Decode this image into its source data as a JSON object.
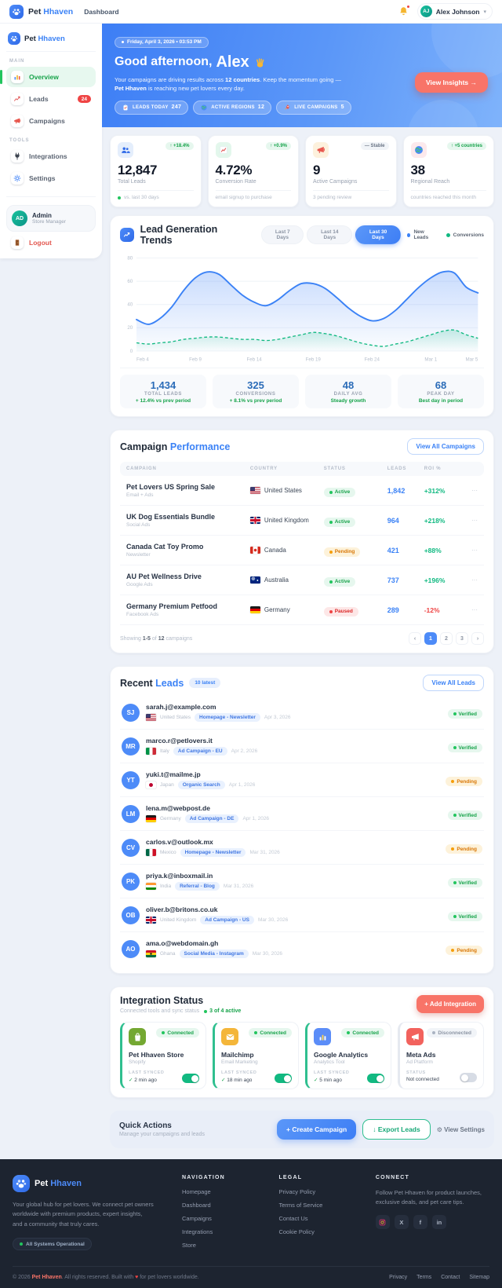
{
  "topnav": {
    "brand": {
      "first": "Pet",
      "second": "Hhaven"
    },
    "links": [
      {
        "label": "Dashboard"
      }
    ],
    "user": {
      "initials": "AJ",
      "name": "Alex Johnson"
    }
  },
  "sidebar": {
    "brand": {
      "first": "Pet",
      "second": "Hhaven"
    },
    "sections": [
      {
        "heading": "MAIN",
        "items": [
          {
            "label": "Overview",
            "icon": "bar-chart-icon",
            "active": true
          },
          {
            "label": "Leads",
            "icon": "trend-line-icon",
            "badge": "24"
          },
          {
            "label": "Campaigns",
            "icon": "megaphone-icon"
          }
        ]
      },
      {
        "heading": "TOOLS",
        "items": [
          {
            "label": "Integrations",
            "icon": "plug-icon"
          },
          {
            "label": "Settings",
            "icon": "gear-icon"
          }
        ]
      }
    ],
    "profile": {
      "initials": "AD",
      "name": "Admin",
      "role": "Store Manager"
    },
    "logout_label": "Logout"
  },
  "hero": {
    "date_pill": "Friday, April 3, 2026 • 03:53 PM",
    "greeting": "Good afternoon,",
    "greeting_name": "Alex",
    "message": {
      "p1": "Your campaigns are driving results across ",
      "b1": "12 countries",
      "p2": ". Keep the momentum going — ",
      "b2": "Pet Hhaven",
      "p3": " is reaching new pet lovers every day."
    },
    "cta_label": "View Insights →",
    "chips": [
      {
        "icon": "clipboard-icon",
        "label": "LEADS TODAY",
        "value": "247"
      },
      {
        "icon": "globe-icon",
        "label": "ACTIVE REGIONS",
        "value": "12"
      },
      {
        "icon": "rocket-icon",
        "label": "LIVE CAMPAIGNS",
        "value": "5"
      }
    ]
  },
  "stat_cards": [
    {
      "icon": "users-icon",
      "tint": "blue",
      "badge": "↑ +18.4%",
      "badge_tone": "positive",
      "value": "12,847",
      "label": "Total Leads",
      "footnote": "vs. last 30 days",
      "footnote_dot": true
    },
    {
      "icon": "chart-up-icon",
      "tint": "green",
      "badge": "↑ +0.9%",
      "badge_tone": "positive",
      "value": "4.72%",
      "label": "Conversion Rate",
      "footnote": "email signup to purchase"
    },
    {
      "icon": "megaphone-icon",
      "tint": "orange",
      "badge": "— Stable",
      "badge_tone": "neutral",
      "value": "9",
      "label": "Active Campaigns",
      "footnote": "3 pending review"
    },
    {
      "icon": "globe-icon",
      "tint": "pink",
      "badge": "↑ +5 countries",
      "badge_tone": "positive",
      "value": "38",
      "label": "Regional Reach",
      "footnote": "countries reached this month"
    }
  ],
  "trends": {
    "title": "Lead Generation Trends",
    "tabs": [
      {
        "label": "Last 7 Days",
        "active": false
      },
      {
        "label": "Last 14 Days",
        "active": false
      },
      {
        "label": "Last 30 Days",
        "active": true
      }
    ],
    "summary": [
      {
        "value": "1,434",
        "label": "TOTAL LEADS",
        "note": "+ 12.4% vs prev period"
      },
      {
        "value": "325",
        "label": "CONVERSIONS",
        "note": "+ 8.1% vs prev period"
      },
      {
        "value": "48",
        "label": "DAILY AVG",
        "note": "Steady growth"
      },
      {
        "value": "68",
        "label": "PEAK DAY",
        "note": "Best day in period"
      }
    ]
  },
  "chart_data": {
    "type": "area",
    "title": "Lead Generation Trends",
    "x_ticks": [
      "Feb 4",
      "Feb 9",
      "Feb 14",
      "Feb 19",
      "Feb 24",
      "Mar 1",
      "Mar 5"
    ],
    "x_tick_indices": [
      0,
      5,
      10,
      15,
      20,
      25,
      29
    ],
    "ylim": [
      0,
      80
    ],
    "y_ticks": [
      0,
      20,
      40,
      60,
      80
    ],
    "grid": true,
    "legend_position": "top-right",
    "series": [
      {
        "name": "New Leads",
        "color": "#3b82f6",
        "style": "solid",
        "values": [
          27,
          23,
          28,
          38,
          52,
          63,
          68,
          66,
          57,
          48,
          42,
          39,
          44,
          52,
          58,
          58,
          54,
          46,
          37,
          30,
          26,
          28,
          35,
          45,
          55,
          63,
          68,
          67,
          55,
          50
        ]
      },
      {
        "name": "Conversions",
        "color": "#10b981",
        "style": "dashed",
        "values": [
          7,
          6,
          7,
          8,
          10,
          11,
          12,
          12,
          11,
          10,
          10,
          9,
          10,
          12,
          14,
          16,
          15,
          13,
          10,
          7,
          5,
          4,
          6,
          8,
          11,
          14,
          17,
          18,
          14,
          11
        ]
      }
    ]
  },
  "campaigns": {
    "title_a": "Campaign",
    "title_b": "Performance",
    "view_all_label": "View All Campaigns",
    "columns": [
      "CAMPAIGN",
      "COUNTRY",
      "STATUS",
      "LEADS",
      "ROI %"
    ],
    "menu_glyph": "···",
    "rows": [
      {
        "name": "Pet Lovers US Spring Sale",
        "channel": "Email + Ads",
        "flag": "us",
        "country": "United States",
        "status": "Active",
        "leads": "1,842",
        "roi": "+312%",
        "roi_tone": "positive"
      },
      {
        "name": "UK Dog Essentials Bundle",
        "channel": "Social Ads",
        "flag": "uk",
        "country": "United Kingdom",
        "status": "Active",
        "leads": "964",
        "roi": "+218%",
        "roi_tone": "positive"
      },
      {
        "name": "Canada Cat Toy Promo",
        "channel": "Newsletter",
        "flag": "ca",
        "country": "Canada",
        "status": "Pending",
        "leads": "421",
        "roi": "+88%",
        "roi_tone": "positive"
      },
      {
        "name": "AU Pet Wellness Drive",
        "channel": "Google Ads",
        "flag": "au",
        "country": "Australia",
        "status": "Active",
        "leads": "737",
        "roi": "+196%",
        "roi_tone": "positive"
      },
      {
        "name": "Germany Premium Petfood",
        "channel": "Facebook Ads",
        "flag": "de",
        "country": "Germany",
        "status": "Paused",
        "leads": "289",
        "roi": "-12%",
        "roi_tone": "negative"
      }
    ],
    "pagination": {
      "prefix": "Showing",
      "range": "1-5",
      "middle": "of",
      "total": "12",
      "suffix": "campaigns",
      "prev": "‹",
      "next": "›",
      "pages": [
        "1",
        "2",
        "3"
      ],
      "active_page": "1"
    }
  },
  "recent_leads": {
    "title_a": "Recent",
    "title_b": "Leads",
    "badge": "10 latest",
    "view_all_label": "View All Leads",
    "items": [
      {
        "initials": "SJ",
        "email": "sarah.j@example.com",
        "flag": "us",
        "country": "United States",
        "tag": "Homepage - Newsletter",
        "date": "Apr 3, 2026",
        "status": "Verified"
      },
      {
        "initials": "MR",
        "email": "marco.r@petlovers.it",
        "flag": "it",
        "country": "Italy",
        "tag": "Ad Campaign - EU",
        "date": "Apr 2, 2026",
        "status": "Verified"
      },
      {
        "initials": "YT",
        "email": "yuki.t@mailme.jp",
        "flag": "jp",
        "country": "Japan",
        "tag": "Organic Search",
        "date": "Apr 1, 2026",
        "status": "Pending"
      },
      {
        "initials": "LM",
        "email": "lena.m@webpost.de",
        "flag": "de",
        "country": "Germany",
        "tag": "Ad Campaign - DE",
        "date": "Apr 1, 2026",
        "status": "Verified"
      },
      {
        "initials": "CV",
        "email": "carlos.v@outlook.mx",
        "flag": "mx",
        "country": "Mexico",
        "tag": "Homepage - Newsletter",
        "date": "Mar 31, 2026",
        "status": "Pending"
      },
      {
        "initials": "PK",
        "email": "priya.k@inboxmail.in",
        "flag": "in",
        "country": "India",
        "tag": "Referral - Blog",
        "date": "Mar 31, 2026",
        "status": "Verified"
      },
      {
        "initials": "OB",
        "email": "oliver.b@britons.co.uk",
        "flag": "uk",
        "country": "United Kingdom",
        "tag": "Ad Campaign - US",
        "date": "Mar 30, 2026",
        "status": "Verified"
      },
      {
        "initials": "AO",
        "email": "ama.o@webdomain.gh",
        "flag": "gh",
        "country": "Ghana",
        "tag": "Social Media - Instagram",
        "date": "Mar 30, 2026",
        "status": "Pending"
      }
    ]
  },
  "integrations": {
    "title": "Integration Status",
    "subtitle": "Connected tools and sync status",
    "active_summary": "3 of 4 active",
    "add_label": "+ Add Integration",
    "cards": [
      {
        "icon": "bag-icon",
        "tint": "green",
        "name": "Pet Hhaven Store",
        "type": "Shopify",
        "status": "Connected",
        "meta_label": "LAST SYNCED",
        "meta_value": "2 min ago",
        "meta_check": true,
        "enabled": true
      },
      {
        "icon": "mail-icon",
        "tint": "amber",
        "name": "Mailchimp",
        "type": "Email Marketing",
        "status": "Connected",
        "meta_label": "LAST SYNCED",
        "meta_value": "18 min ago",
        "meta_check": true,
        "enabled": true
      },
      {
        "icon": "analytics-icon",
        "tint": "blue",
        "name": "Google Analytics",
        "type": "Analytics Tool",
        "status": "Connected",
        "meta_label": "LAST SYNCED",
        "meta_value": "5 min ago",
        "meta_check": true,
        "enabled": true
      },
      {
        "icon": "ads-icon",
        "tint": "red",
        "name": "Meta Ads",
        "type": "Ad Platform",
        "status": "Disconnected",
        "meta_label": "STATUS",
        "meta_value": "Not connected",
        "meta_check": false,
        "enabled": false
      }
    ]
  },
  "quick_actions": {
    "title": "Quick Actions",
    "subtitle": "Manage your campaigns and leads",
    "create_label": "+ Create Campaign",
    "export_label": "↓ Export Leads",
    "settings_label": "⚙ View Settings"
  },
  "footer": {
    "brand": {
      "first": "Pet",
      "second": "Hhaven"
    },
    "description": "Your global hub for pet lovers. We connect pet owners worldwide with premium products, expert insights, and a community that truly cares.",
    "status_badge": "All Systems Operational",
    "columns": [
      {
        "heading": "NAVIGATION",
        "links": [
          "Homepage",
          "Dashboard",
          "Campaigns",
          "Integrations",
          "Store"
        ]
      },
      {
        "heading": "LEGAL",
        "links": [
          "Privacy Policy",
          "Terms of Service",
          "Contact Us",
          "Cookie Policy"
        ]
      }
    ],
    "connect": {
      "heading": "CONNECT",
      "text": "Follow Pet Hhaven for product launches, exclusive deals, and pet care tips.",
      "socials": [
        "instagram",
        "x",
        "facebook",
        "linkedin"
      ]
    },
    "bottom": {
      "p1": "© 2026 ",
      "brand": "Pet Hhaven",
      "p2": ". All rights reserved. Built with ",
      "heart": "♥",
      "p3": " for pet lovers worldwide.",
      "links": [
        "Privacy",
        "Terms",
        "Contact",
        "Sitemap"
      ]
    }
  },
  "colors": {
    "primary": "#3b82f6",
    "accent_coral": "#f87468",
    "success": "#16a34a",
    "warning": "#f59e0b",
    "danger": "#ef4444",
    "hero_gradient": [
      "#3d7ef5",
      "#7fb3fb"
    ]
  }
}
